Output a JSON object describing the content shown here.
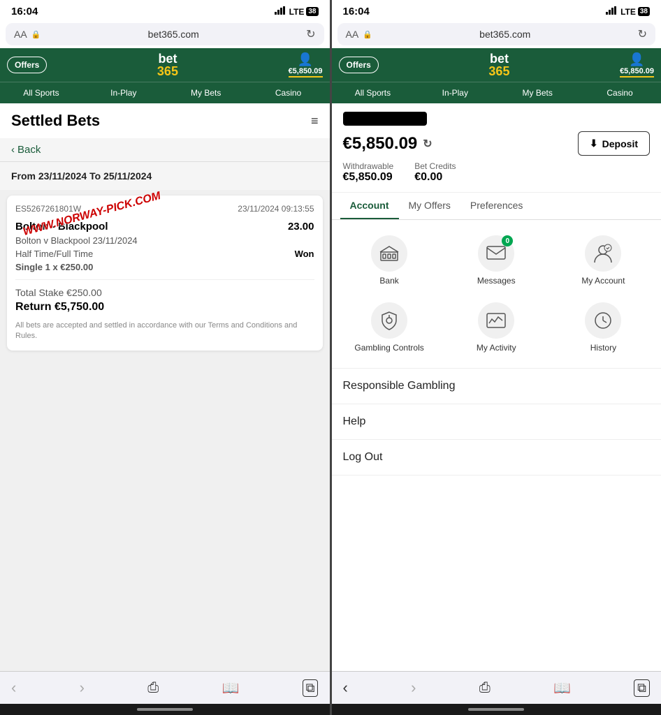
{
  "phones": [
    {
      "id": "left",
      "status": {
        "time": "16:04",
        "signal": "●●●●",
        "network": "LTE",
        "battery": "38"
      },
      "browser": {
        "aa": "AA",
        "lock": "🔒",
        "domain": "bet365.com",
        "refresh": "↻"
      },
      "header": {
        "offers": "Offers",
        "logo_top": "bet",
        "logo_bottom": "365",
        "balance": "€5,850.09"
      },
      "sports_nav": [
        {
          "label": "All Sports",
          "active": false
        },
        {
          "label": "In-Play",
          "active": false
        },
        {
          "label": "My Bets",
          "active": false
        },
        {
          "label": "Casino",
          "active": false
        }
      ],
      "content": {
        "page_title": "Settled Bets",
        "back_label": "Back",
        "date_range": "From 23/11/2024 To 25/11/2024",
        "watermark": "WWW.NORWAY-PICK.COM",
        "bet": {
          "ref": "ES5267261801W",
          "date": "23/11/2024 09:13:55",
          "match": "Bolton - Blackpool",
          "odds": "23.00",
          "match_detail": "Bolton v Blackpool 23/11/2024",
          "bet_type": "Half Time/Full Time",
          "result": "Won",
          "stake_type": "Single 1 x €250.00",
          "total_stake": "Total Stake €250.00",
          "return": "Return €5,750.00",
          "disclaimer": "All bets are accepted and settled in accordance with our Terms and Conditions and Rules."
        }
      },
      "browser_nav": {
        "back": "‹",
        "forward": "›",
        "share": "⎙",
        "book": "□",
        "tabs": "⧉"
      }
    },
    {
      "id": "right",
      "status": {
        "time": "16:04",
        "signal": "●●●●",
        "network": "LTE",
        "battery": "38"
      },
      "browser": {
        "aa": "AA",
        "lock": "🔒",
        "domain": "bet365.com",
        "refresh": "↻"
      },
      "header": {
        "offers": "Offers",
        "logo_top": "bet",
        "logo_bottom": "365",
        "balance": "€5,850.09"
      },
      "sports_nav": [
        {
          "label": "All Sports",
          "active": false
        },
        {
          "label": "In-Play",
          "active": false
        },
        {
          "label": "My Bets",
          "active": false
        },
        {
          "label": "Casino",
          "active": false
        }
      ],
      "content": {
        "username_hidden": "████████",
        "balance": "€5,850.09",
        "deposit_btn": "Deposit",
        "withdrawable_label": "Withdrawable",
        "withdrawable_amount": "€5,850.09",
        "bet_credits_label": "Bet Credits",
        "bet_credits_amount": "€0.00",
        "tabs": [
          {
            "label": "Account",
            "active": true
          },
          {
            "label": "My Offers",
            "active": false
          },
          {
            "label": "Preferences",
            "active": false
          }
        ],
        "icons": [
          {
            "icon": "👜",
            "label": "Bank",
            "badge": null
          },
          {
            "icon": "✉",
            "label": "Messages",
            "badge": "0"
          },
          {
            "icon": "👤",
            "label": "My Account",
            "badge": null
          },
          {
            "icon": "🔒",
            "label": "Gambling Controls",
            "badge": null
          },
          {
            "icon": "📈",
            "label": "My Activity",
            "badge": null
          },
          {
            "icon": "🕐",
            "label": "History",
            "badge": null
          }
        ],
        "menu_items": [
          {
            "label": "Responsible Gambling"
          },
          {
            "label": "Help"
          },
          {
            "label": "Log Out"
          }
        ]
      },
      "browser_nav": {
        "back": "‹",
        "forward": "›",
        "share": "⎙",
        "book": "□",
        "tabs": "⧉"
      }
    }
  ]
}
